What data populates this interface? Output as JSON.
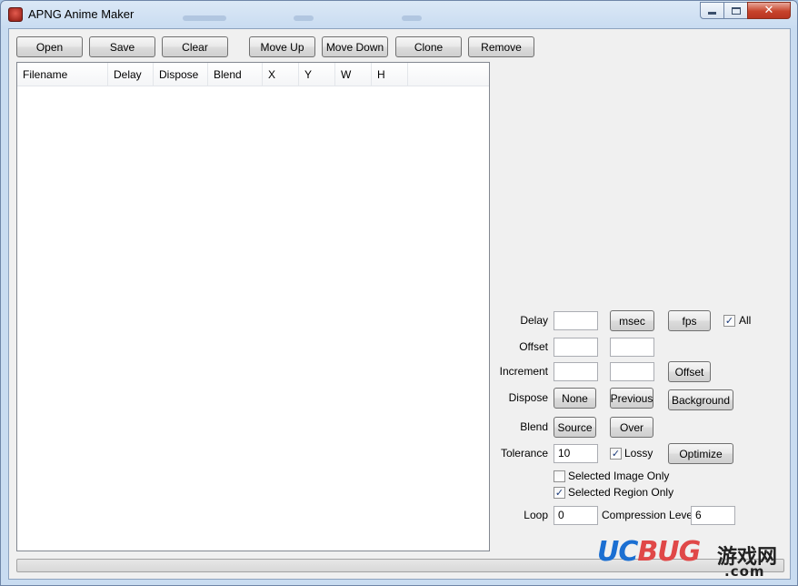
{
  "window": {
    "title": "APNG Anime Maker",
    "controls": {
      "minimize": "minimize-icon",
      "maximize": "maximize-icon",
      "close": "close-icon"
    }
  },
  "toolbar": {
    "open": "Open",
    "save": "Save",
    "clear": "Clear",
    "move_up": "Move Up",
    "move_down": "Move Down",
    "clone": "Clone",
    "remove": "Remove"
  },
  "list": {
    "columns": [
      "Filename",
      "Delay",
      "Dispose",
      "Blend",
      "X",
      "Y",
      "W",
      "H"
    ],
    "rows": []
  },
  "settings": {
    "delay": {
      "label": "Delay",
      "value": "",
      "msec_button": "msec",
      "fps_button": "fps",
      "all_label": "All",
      "all_checked": true
    },
    "offset": {
      "label": "Offset",
      "x_value": "",
      "y_value": ""
    },
    "increment": {
      "label": "Increment",
      "x_value": "",
      "y_value": "",
      "offset_button": "Offset"
    },
    "dispose": {
      "label": "Dispose",
      "none_button": "None",
      "previous_button": "Previous",
      "background_button": "Background"
    },
    "blend": {
      "label": "Blend",
      "source_button": "Source",
      "over_button": "Over"
    },
    "tolerance": {
      "label": "Tolerance",
      "value": "10",
      "lossy_label": "Lossy",
      "lossy_checked": true,
      "optimize_button": "Optimize"
    },
    "selected_image_only": {
      "label": "Selected Image Only",
      "checked": false
    },
    "selected_region_only": {
      "label": "Selected Region Only",
      "checked": true
    },
    "loop": {
      "label": "Loop",
      "value": "0"
    },
    "compression": {
      "label": "Compression Level",
      "value": "6"
    }
  },
  "progress": {
    "value_percent": 0
  },
  "watermark": {
    "logo_uc": "UC",
    "logo_bug": "BUG",
    "logo_cn": "游戏网",
    "domain": ".com"
  },
  "colors": {
    "accent": "#3399ff",
    "progress": "#37b21f",
    "watermark_blue": "#1b6fd2",
    "watermark_red": "#e04848"
  }
}
